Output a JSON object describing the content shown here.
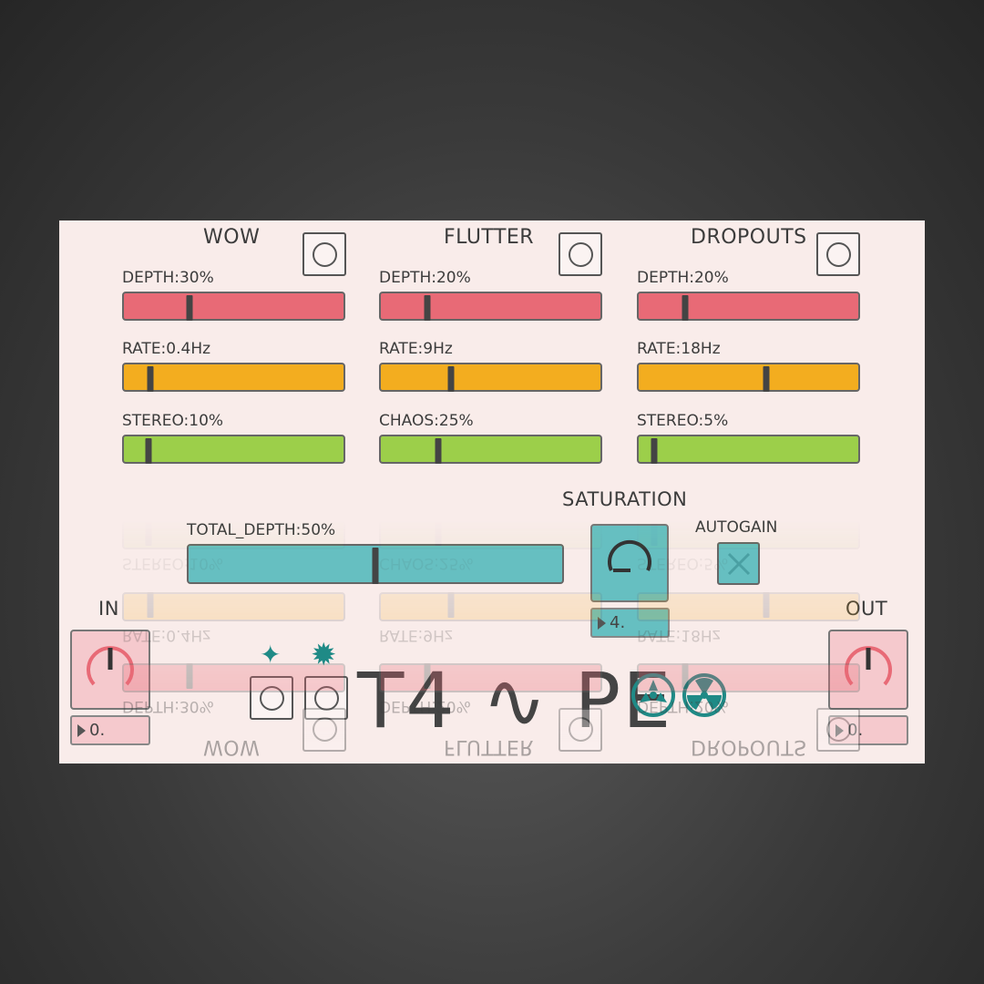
{
  "wow": {
    "title": "WOW",
    "sliders": [
      {
        "label": "DEPTH:30%",
        "value": 0.3,
        "color": "#e86a76"
      },
      {
        "label": "RATE:0.4Hz",
        "value": 0.12,
        "color": "#f3ad1f"
      },
      {
        "label": "STEREO:10%",
        "value": 0.11,
        "color": "#9ccf4a"
      }
    ]
  },
  "flutter": {
    "title": "FLUTTER",
    "sliders": [
      {
        "label": "DEPTH:20%",
        "value": 0.21,
        "color": "#e86a76"
      },
      {
        "label": "RATE:9Hz",
        "value": 0.32,
        "color": "#f3ad1f"
      },
      {
        "label": "CHAOS:25%",
        "value": 0.26,
        "color": "#9ccf4a"
      }
    ]
  },
  "dropouts": {
    "title": "DROPOUTS",
    "sliders": [
      {
        "label": "DEPTH:20%",
        "value": 0.21,
        "color": "#e86a76"
      },
      {
        "label": "RATE:18Hz",
        "value": 0.58,
        "color": "#f3ad1f"
      },
      {
        "label": "STEREO:5%",
        "value": 0.07,
        "color": "#9ccf4a"
      }
    ]
  },
  "total_depth": {
    "label": "TOTAL_DEPTH:50%",
    "value": 0.5
  },
  "saturation": {
    "title": "SATURATION",
    "value_display": "4."
  },
  "autogain": {
    "label": "AUTOGAIN",
    "checked": true
  },
  "input": {
    "label": "IN",
    "value_display": "0."
  },
  "output": {
    "label": "OUT",
    "value_display": "0."
  },
  "logo": {
    "text": "T4 ∿ PE"
  },
  "icons": {
    "sparkle": "four-point-star-icon",
    "burst": "eight-point-star-icon",
    "reel_left": "tape-reel-icon",
    "reel_right": "radiation-reel-icon"
  },
  "colors": {
    "panel": "#f9ecea",
    "red": "#e86a76",
    "orange": "#f3ad1f",
    "green": "#9ccf4a",
    "teal": "#66bfc1",
    "pink": "#f5c9cd",
    "icon_teal": "#1f8a86"
  }
}
